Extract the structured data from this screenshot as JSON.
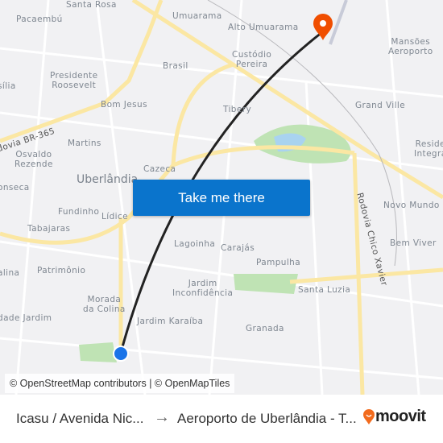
{
  "map": {
    "labels": [
      {
        "text": "Santa Rosa",
        "cls": ""
      },
      {
        "text": "Pacaembú",
        "cls": ""
      },
      {
        "text": "Umuarama",
        "cls": ""
      },
      {
        "text": "Alto Umuarama",
        "cls": ""
      },
      {
        "text": "Mansões\nAeroporto",
        "cls": ""
      },
      {
        "text": "Custódio\nPereira",
        "cls": ""
      },
      {
        "text": "Brasil",
        "cls": ""
      },
      {
        "text": "Presidente\nRoosevelt",
        "cls": ""
      },
      {
        "text": "sília",
        "cls": ""
      },
      {
        "text": "Bom Jesus",
        "cls": ""
      },
      {
        "text": "Tibery",
        "cls": ""
      },
      {
        "text": "Grand Ville",
        "cls": ""
      },
      {
        "text": "Martins",
        "cls": ""
      },
      {
        "text": "Osvaldo\nRezende",
        "cls": ""
      },
      {
        "text": "Reside\nIntegra",
        "cls": ""
      },
      {
        "text": "Cazeca",
        "cls": ""
      },
      {
        "text": "Uberlândia",
        "cls": "big"
      },
      {
        "text": "onseca",
        "cls": ""
      },
      {
        "text": "Fundinho",
        "cls": ""
      },
      {
        "text": "Lídice",
        "cls": ""
      },
      {
        "text": "Novo Mundo",
        "cls": ""
      },
      {
        "text": "Tabajaras",
        "cls": ""
      },
      {
        "text": "Lagoinha",
        "cls": ""
      },
      {
        "text": "Carajás",
        "cls": ""
      },
      {
        "text": "Bem Viver",
        "cls": ""
      },
      {
        "text": "Patrimônio",
        "cls": ""
      },
      {
        "text": "Pampulha",
        "cls": ""
      },
      {
        "text": "alina",
        "cls": ""
      },
      {
        "text": "Jardim\nInconfidência",
        "cls": ""
      },
      {
        "text": "Santa Luzia",
        "cls": ""
      },
      {
        "text": "Morada\nda Colina",
        "cls": ""
      },
      {
        "text": "dade Jardim",
        "cls": ""
      },
      {
        "text": "Jardim Karaíba",
        "cls": ""
      },
      {
        "text": "Granada",
        "cls": ""
      },
      {
        "text": "dovia BR-365",
        "cls": ""
      },
      {
        "text": "Rodovia Chico Xavier",
        "cls": ""
      }
    ],
    "colors": {
      "route": "#222222",
      "origin": "#1a73e8",
      "destination": "#f04e00",
      "major_road": "#fbe7a3",
      "park": "#bfe3b4",
      "water": "#a9d3f0"
    },
    "origin_icon": "origin-dot-icon",
    "destination_icon": "destination-pin-icon"
  },
  "cta": {
    "label": "Take me there"
  },
  "attribution": {
    "osm": "© OpenStreetMap contributors",
    "sep": " | ",
    "omt": "© OpenMapTiles"
  },
  "footer": {
    "from": "Icasu / Avenida Nic...",
    "arrow": "→",
    "to": "Aeroporto de Uberlândia - T...",
    "brand": "moovit"
  }
}
